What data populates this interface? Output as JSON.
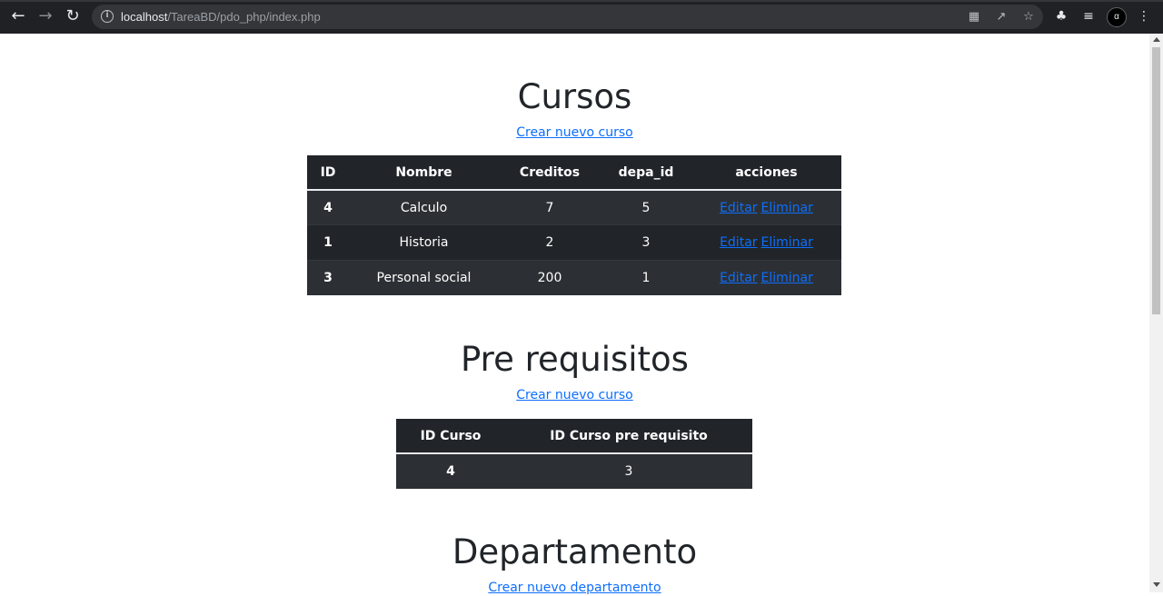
{
  "browser": {
    "url_host": "localhost",
    "url_path": "/TareaBD/pdo_php/index.php"
  },
  "cursos": {
    "title": "Cursos",
    "create_link": "Crear nuevo curso",
    "headers": [
      "ID",
      "Nombre",
      "Creditos",
      "depa_id",
      "acciones"
    ],
    "rows": [
      {
        "id": "4",
        "nombre": "Calculo",
        "creditos": "7",
        "depa_id": "5",
        "edit": "Editar",
        "delete": "Eliminar"
      },
      {
        "id": "1",
        "nombre": "Historia",
        "creditos": "2",
        "depa_id": "3",
        "edit": "Editar",
        "delete": "Eliminar"
      },
      {
        "id": "3",
        "nombre": "Personal social",
        "creditos": "200",
        "depa_id": "1",
        "edit": "Editar",
        "delete": "Eliminar"
      }
    ]
  },
  "prerequisitos": {
    "title": "Pre requisitos",
    "create_link": "Crear nuevo curso",
    "headers": [
      "ID Curso",
      "ID Curso pre requisito"
    ],
    "rows": [
      {
        "id_curso": "4",
        "id_pre": "3"
      }
    ]
  },
  "departamento": {
    "title": "Departamento",
    "create_link": "Crear nuevo departamento"
  }
}
